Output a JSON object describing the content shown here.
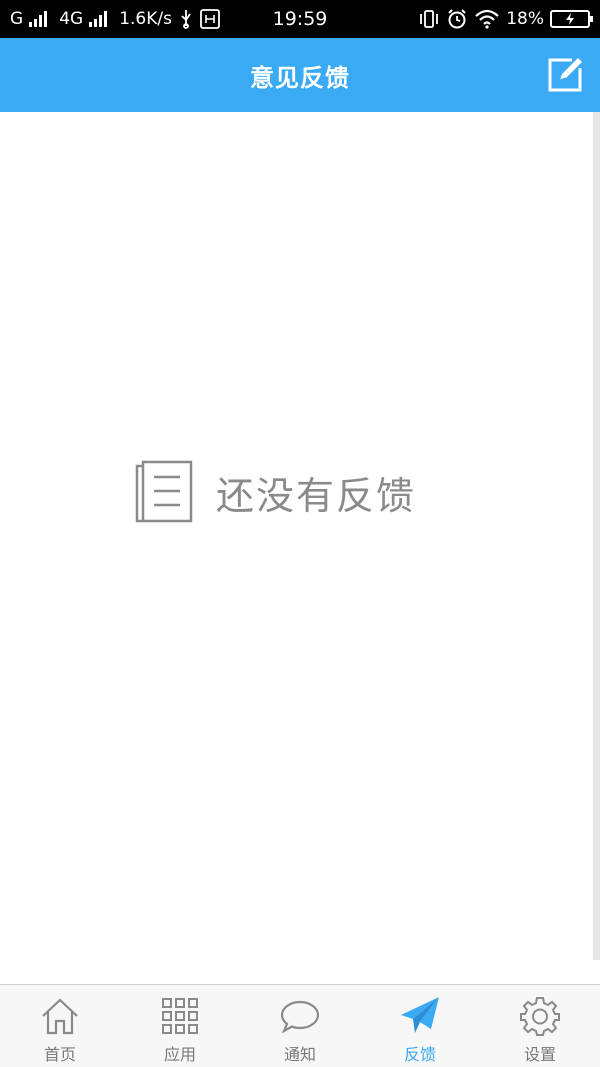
{
  "status_bar": {
    "carrier1": "G",
    "carrier2": "4G",
    "net_speed": "1.6K/s",
    "time": "19:59",
    "battery": "18%"
  },
  "header": {
    "title": "意见反馈",
    "edit_icon": "edit-icon"
  },
  "empty_state": {
    "icon": "document-icon",
    "text": "还没有反馈"
  },
  "nav": {
    "items": [
      {
        "label": "首页",
        "icon": "home-icon"
      },
      {
        "label": "应用",
        "icon": "grid-icon"
      },
      {
        "label": "通知",
        "icon": "chat-bubble-icon"
      },
      {
        "label": "反馈",
        "icon": "paper-plane-icon",
        "active": true
      },
      {
        "label": "设置",
        "icon": "gear-icon"
      }
    ]
  },
  "colors": {
    "accent": "#3aaaf5",
    "icon_gray": "#8a8a8a"
  }
}
